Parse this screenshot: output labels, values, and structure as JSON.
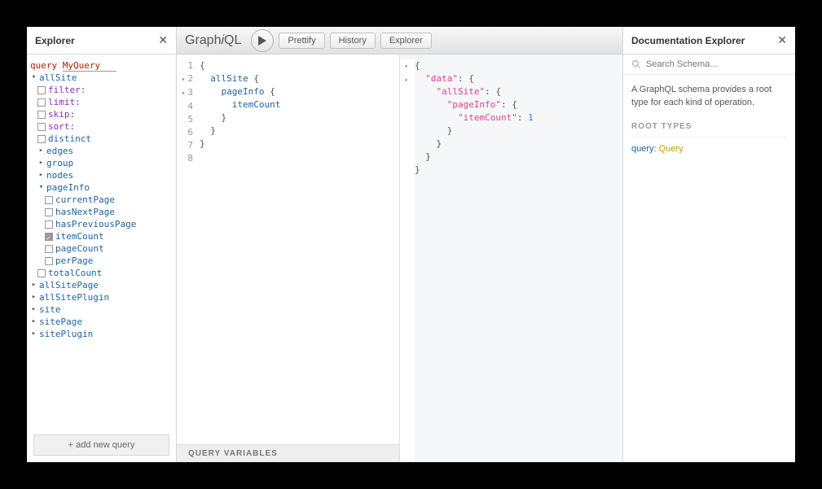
{
  "explorer": {
    "title": "Explorer",
    "query_keyword": "query",
    "query_name": "MyQuery",
    "root": "allSite",
    "args": [
      "filter:",
      "limit:",
      "skip:",
      "sort:"
    ],
    "distinct": "distinct",
    "sections": [
      "edges",
      "group",
      "nodes"
    ],
    "pageInfo": "pageInfo",
    "pageInfoFields": [
      "currentPage",
      "hasNextPage",
      "hasPreviousPage",
      "itemCount",
      "pageCount",
      "perPage"
    ],
    "checked_field": "itemCount",
    "totalCount": "totalCount",
    "extra_roots": [
      "allSitePage",
      "allSitePlugin",
      "site",
      "sitePage",
      "sitePlugin"
    ],
    "add_query": "+ add new query"
  },
  "toolbar": {
    "logo_a": "Graph",
    "logo_i": "i",
    "logo_b": "QL",
    "prettify": "Prettify",
    "history": "History",
    "explorer": "Explorer"
  },
  "query_editor": {
    "lines": [
      [
        {
          "t": "{",
          "c": "tok-punc"
        }
      ],
      [
        {
          "t": "  ",
          "c": ""
        },
        {
          "t": "allSite",
          "c": "tok-kw"
        },
        {
          "t": " {",
          "c": "tok-punc"
        }
      ],
      [
        {
          "t": "    ",
          "c": ""
        },
        {
          "t": "pageInfo",
          "c": "tok-kw"
        },
        {
          "t": " {",
          "c": "tok-punc"
        }
      ],
      [
        {
          "t": "      ",
          "c": ""
        },
        {
          "t": "itemCount",
          "c": "tok-kw"
        }
      ],
      [
        {
          "t": "    }",
          "c": "tok-punc"
        }
      ],
      [
        {
          "t": "  }",
          "c": "tok-punc"
        }
      ],
      [
        {
          "t": "}",
          "c": "tok-punc"
        }
      ],
      [
        {
          "t": "",
          "c": ""
        }
      ]
    ],
    "qvars": "QUERY VARIABLES"
  },
  "result": {
    "lines": [
      [
        {
          "t": "{",
          "c": "tok-punc"
        }
      ],
      [
        {
          "t": "  ",
          "c": ""
        },
        {
          "t": "\"data\"",
          "c": "tok-str"
        },
        {
          "t": ": {",
          "c": "tok-punc"
        }
      ],
      [
        {
          "t": "    ",
          "c": ""
        },
        {
          "t": "\"allSite\"",
          "c": "tok-str"
        },
        {
          "t": ": {",
          "c": "tok-punc"
        }
      ],
      [
        {
          "t": "      ",
          "c": ""
        },
        {
          "t": "\"pageInfo\"",
          "c": "tok-str"
        },
        {
          "t": ": {",
          "c": "tok-punc"
        }
      ],
      [
        {
          "t": "        ",
          "c": ""
        },
        {
          "t": "\"itemCount\"",
          "c": "tok-str"
        },
        {
          "t": ": ",
          "c": "tok-punc"
        },
        {
          "t": "1",
          "c": "tok-num"
        }
      ],
      [
        {
          "t": "      }",
          "c": "tok-punc"
        }
      ],
      [
        {
          "t": "    }",
          "c": "tok-punc"
        }
      ],
      [
        {
          "t": "  }",
          "c": "tok-punc"
        }
      ],
      [
        {
          "t": "}",
          "c": "tok-punc"
        }
      ]
    ]
  },
  "docs": {
    "title": "Documentation Explorer",
    "search_placeholder": "Search Schema...",
    "intro": "A GraphQL schema provides a root type for each kind of operation.",
    "section": "ROOT TYPES",
    "root_field": "query",
    "root_type": "Query"
  }
}
